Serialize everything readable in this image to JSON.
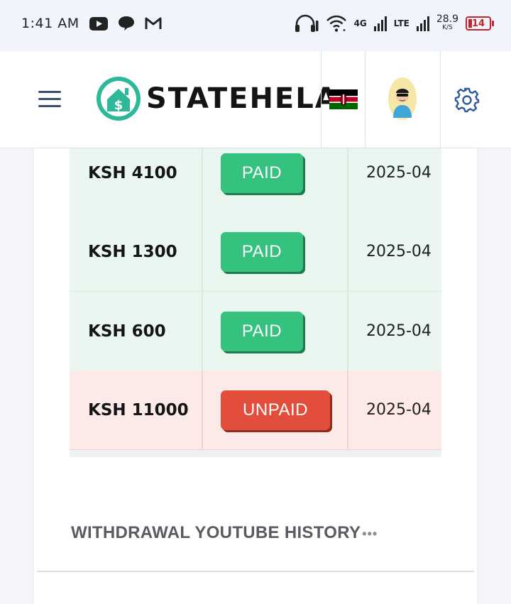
{
  "status_bar": {
    "time": "1:41 AM",
    "net_4g": "4G",
    "net_lte": "LTE",
    "speed_value": "28.9",
    "speed_unit": "K/S",
    "battery": "14",
    "icons": [
      "youtube-icon",
      "chat-icon",
      "gmail-icon",
      "headphones-icon",
      "wifi-icon",
      "signal-icon",
      "battery-icon"
    ]
  },
  "header": {
    "brand": "STATEHELA",
    "flag": "kenya-flag",
    "accent_color": "#2db89a"
  },
  "payments": {
    "rows": [
      {
        "amount": "KSH 4100",
        "status": "PAID",
        "date": "2025-04"
      },
      {
        "amount": "KSH 1300",
        "status": "PAID",
        "date": "2025-04"
      },
      {
        "amount": "KSH 600",
        "status": "PAID",
        "date": "2025-04"
      },
      {
        "amount": "KSH 11000",
        "status": "UNPAID",
        "date": "2025-04"
      }
    ],
    "colors": {
      "paid": "#34c27e",
      "unpaid": "#e24e3b"
    }
  },
  "section": {
    "title": "WITHDRAWAL YOUTUBE HISTORY",
    "more": "•••"
  }
}
